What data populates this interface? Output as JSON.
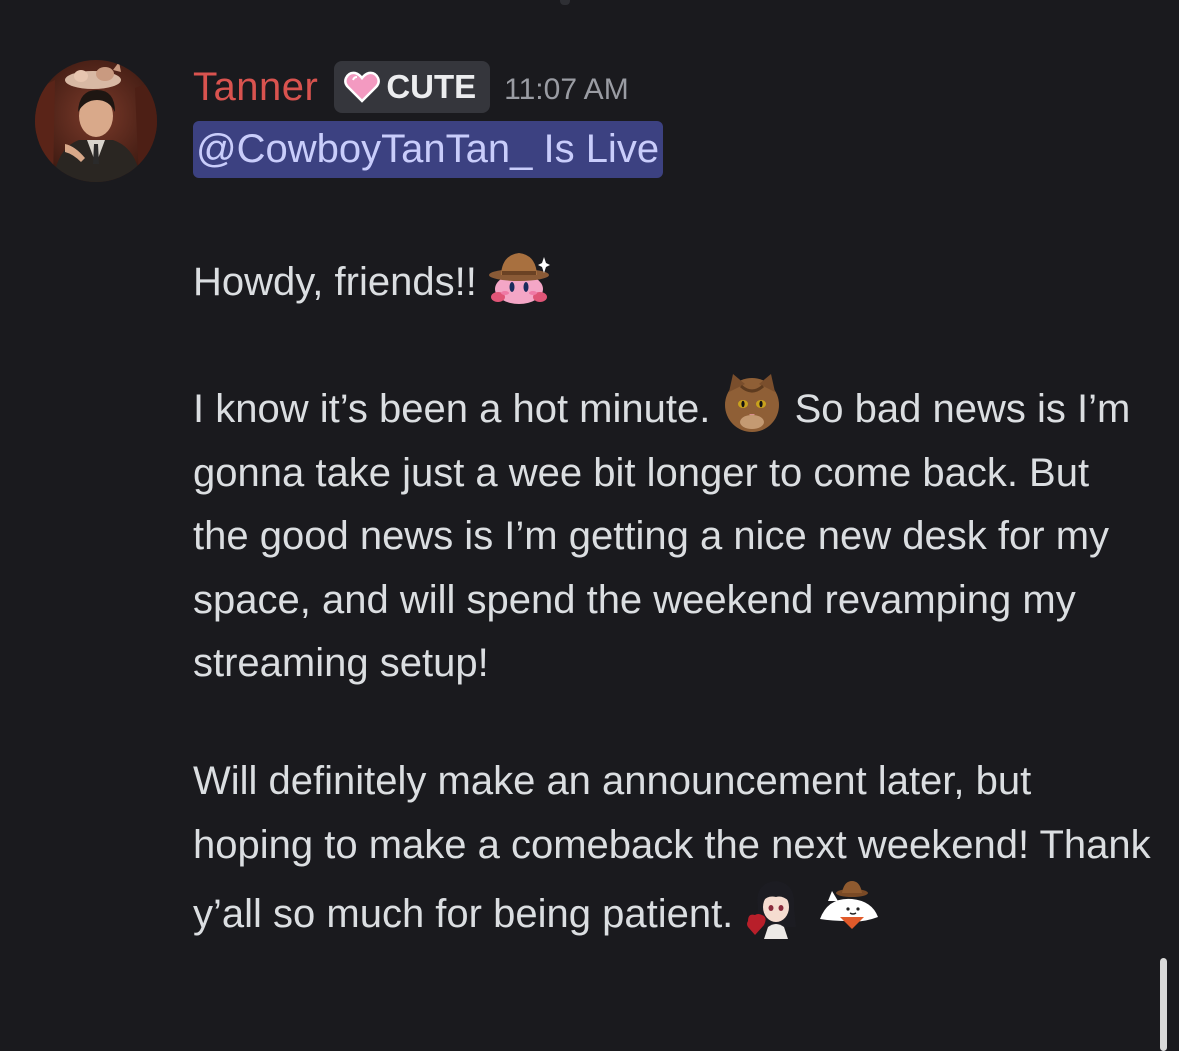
{
  "message": {
    "author": "Tanner",
    "role_badge": {
      "label": "CUTE",
      "icon": "pink-heart-icon"
    },
    "timestamp": "11:07 AM",
    "mention": "@CowboyTanTan_ Is Live",
    "paragraphs": {
      "p1": "Howdy, friends!!",
      "p2_a": "I know it’s been a hot minute.",
      "p2_b": "So bad news is I’m gonna take just a wee bit longer to come back. But the good news is I’m getting a nice new desk for my space, and will spend the weekend revamping my streaming setup!",
      "p3": "Will definitely make an announcement later, but hoping to make a comeback the next weekend! Thank y’all so much for being patient."
    },
    "emojis": {
      "e1": "kirby-cowboy-emoji",
      "e2": "cat-face-emoji",
      "e3": "anime-girl-heart-emoji",
      "e4": "cowboy-cat-emoji"
    }
  },
  "colors": {
    "background": "#1a1a1e",
    "author": "#d9534f",
    "mention_bg": "#3c4181",
    "mention_text": "#c9cdfb",
    "text": "#dbdee1",
    "timestamp": "#9a9ca3"
  }
}
